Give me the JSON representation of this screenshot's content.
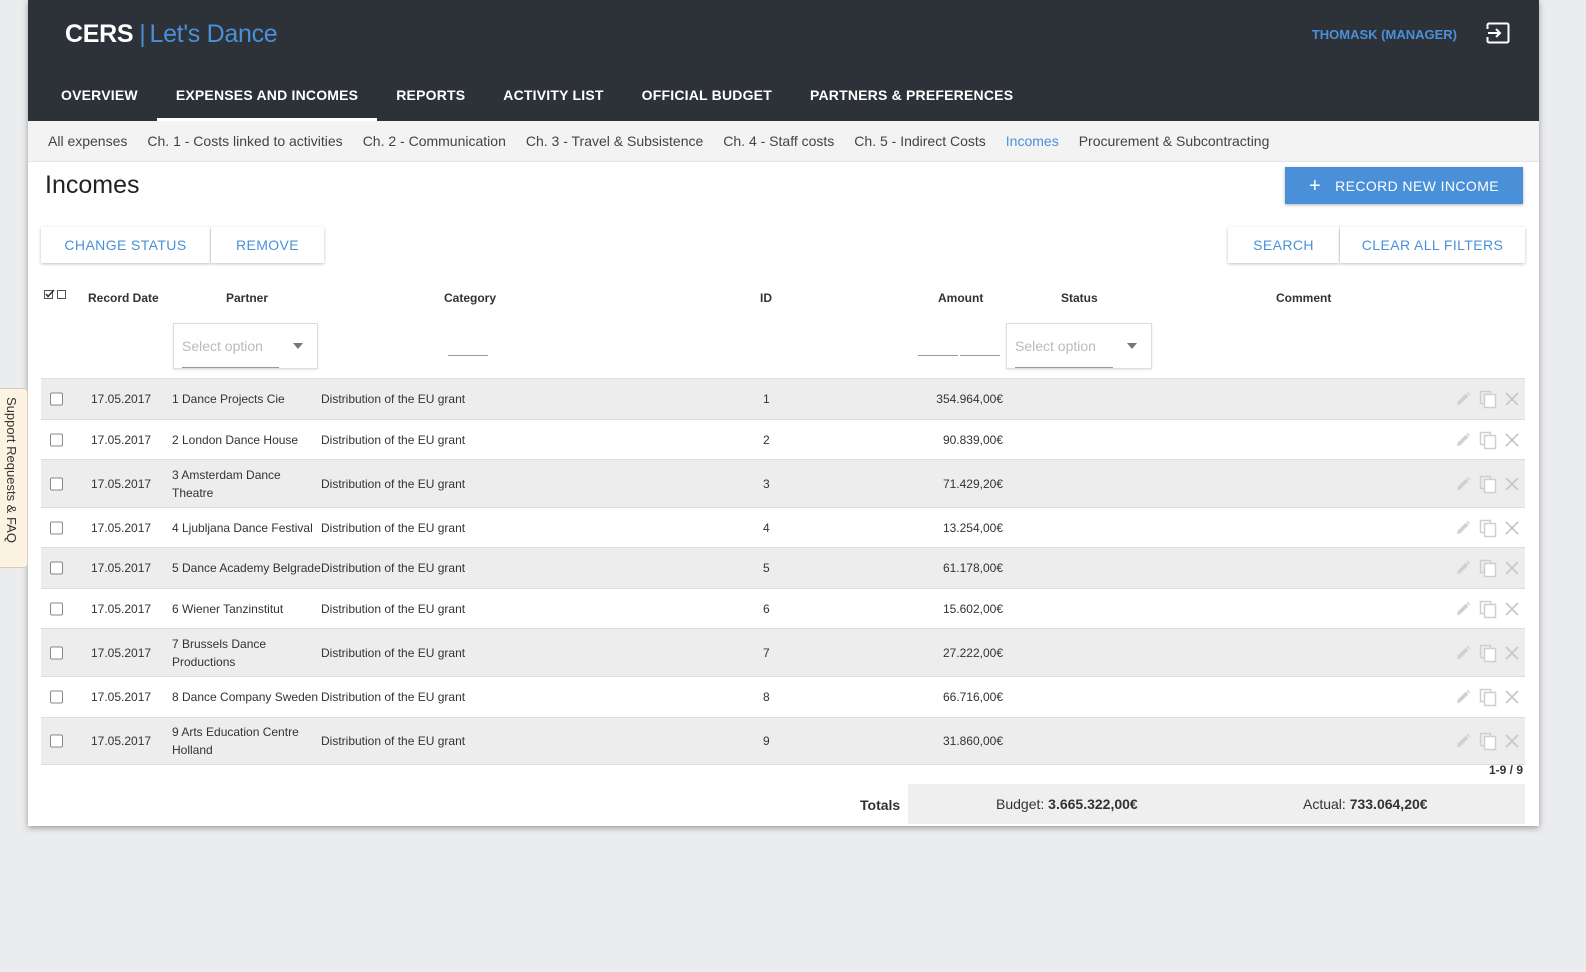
{
  "header": {
    "brand": "CERS",
    "separator": "|",
    "project": "Let's Dance",
    "user": "THOMASK (MANAGER)",
    "logout_icon": "logout-icon"
  },
  "main_nav": [
    {
      "label": "OVERVIEW",
      "active": false
    },
    {
      "label": "EXPENSES AND INCOMES",
      "active": true
    },
    {
      "label": "REPORTS",
      "active": false
    },
    {
      "label": "ACTIVITY LIST",
      "active": false
    },
    {
      "label": "OFFICIAL BUDGET",
      "active": false
    },
    {
      "label": "PARTNERS & PREFERENCES",
      "active": false
    }
  ],
  "sub_nav": [
    {
      "label": "All expenses",
      "active": false
    },
    {
      "label": "Ch. 1 - Costs linked to activities",
      "active": false
    },
    {
      "label": "Ch. 2 - Communication",
      "active": false
    },
    {
      "label": "Ch. 3 - Travel & Subsistence",
      "active": false
    },
    {
      "label": "Ch. 4 - Staff costs",
      "active": false
    },
    {
      "label": "Ch. 5 - Indirect Costs",
      "active": false
    },
    {
      "label": "Incomes",
      "active": true
    },
    {
      "label": "Procurement & Subcontracting",
      "active": false
    }
  ],
  "page": {
    "title": "Incomes",
    "record_button": "RECORD NEW INCOME",
    "record_button_icon": "+",
    "change_status": "CHANGE STATUS",
    "remove": "REMOVE",
    "search": "SEARCH",
    "clear_filters": "CLEAR ALL FILTERS"
  },
  "table": {
    "columns": {
      "record_date": "Record Date",
      "partner": "Partner",
      "category": "Category",
      "id": "ID",
      "amount": "Amount",
      "status": "Status",
      "comment": "Comment"
    },
    "filters": {
      "partner_placeholder": "Select option",
      "status_placeholder": "Select option"
    },
    "rows": [
      {
        "date": "17.05.2017",
        "partner": "1 Dance Projects Cie",
        "category": "Distribution of the EU grant",
        "id": "1",
        "amount": "354.964,00€",
        "height": 40
      },
      {
        "date": "17.05.2017",
        "partner": "2 London Dance House",
        "category": "Distribution of the EU grant",
        "id": "2",
        "amount": "90.839,00€",
        "height": 39
      },
      {
        "date": "17.05.2017",
        "partner": "3 Amsterdam Dance Theatre",
        "category": "Distribution of the EU grant",
        "id": "3",
        "amount": "71.429,20€",
        "height": 47
      },
      {
        "date": "17.05.2017",
        "partner": "4 Ljubljana Dance Festival",
        "category": "Distribution of the EU grant",
        "id": "4",
        "amount": "13.254,00€",
        "height": 39
      },
      {
        "date": "17.05.2017",
        "partner": "5 Dance Academy Belgrade",
        "category": "Distribution of the EU grant",
        "id": "5",
        "amount": "61.178,00€",
        "height": 40
      },
      {
        "date": "17.05.2017",
        "partner": "6 Wiener Tanzinstitut",
        "category": "Distribution of the EU grant",
        "id": "6",
        "amount": "15.602,00€",
        "height": 39
      },
      {
        "date": "17.05.2017",
        "partner": "7 Brussels Dance Productions",
        "category": "Distribution of the EU grant",
        "id": "7",
        "amount": "27.222,00€",
        "height": 47
      },
      {
        "date": "17.05.2017",
        "partner": "8 Dance Company Sweden",
        "category": "Distribution of the EU grant",
        "id": "8",
        "amount": "66.716,00€",
        "height": 40
      },
      {
        "date": "17.05.2017",
        "partner": "9 Arts Education Centre Holland",
        "category": "Distribution of the EU grant",
        "id": "9",
        "amount": "31.860,00€",
        "height": 46
      }
    ],
    "pager": "1-9 / 9"
  },
  "totals": {
    "label": "Totals",
    "budget_label": "Budget:",
    "budget_value": "3.665.322,00€",
    "actual_label": "Actual:",
    "actual_value": "733.064,20€"
  },
  "side_tab": "Support Requests & FAQ",
  "colors": {
    "accent": "#4a90d9",
    "topbar": "#2d3238"
  }
}
